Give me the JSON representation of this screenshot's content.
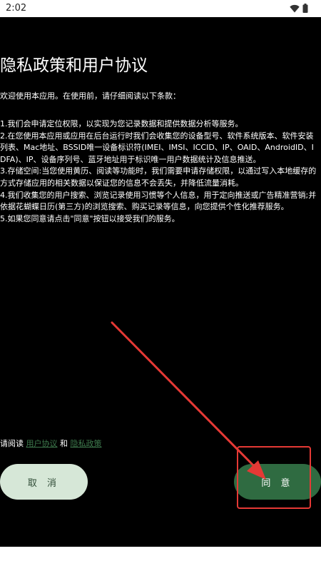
{
  "status_bar": {
    "time": "2:02"
  },
  "dialog": {
    "title": "隐私政策和用户协议",
    "intro": "欢迎使用本应用。在使用前，请仔细阅读以下条款：",
    "terms": [
      "1.我们会申请定位权限，以实现为您记录数据和提供数据分析等服务。",
      "2.在您使用本应用或应用在后台运行时我们会收集您的设备型号、软件系统版本、软件安装列表、Mac地址、BSSID唯一设备标识符(IMEI、IMSI、ICCID、IP、OAID、AndroidID、IDFA)、IP、设备序列号、蓝牙地址用于标识唯一用户数据统计及信息推送。",
      "3.存储空间:当您使用黄历、阅读等功能时，我们需要申请存储权限，以通过写入本地缓存的方式存储应用的相关数据以保证您的信息不会丢失，并降低流量消耗。",
      "4.我们收集您的用户搜索、浏览记录使用习惯等个人信息，用于定向推送或广告精准营销;并依据花蝴蝶日历(第三方)的浏览搜索、购买记录等信息，向您提供个性化推荐服务。",
      "5.如果您同意请点击\"同意\"按钮以接受我们的服务。"
    ],
    "agreement": {
      "prefix": "请阅读 ",
      "user_agreement_link": "用户协议",
      "and": " 和 ",
      "privacy_policy_link": "隐私政策"
    },
    "buttons": {
      "cancel_label": "取 消",
      "agree_label": "同 意"
    }
  },
  "colors": {
    "background": "#000000",
    "link": "#3e7a4d",
    "cancel_bg": "#d6e7d7",
    "agree_bg": "#2f6b41",
    "annotation": "#e53935"
  },
  "icons": {
    "status": [
      "wifi-icon",
      "battery-icon"
    ],
    "annotation": "arrow-icon"
  }
}
